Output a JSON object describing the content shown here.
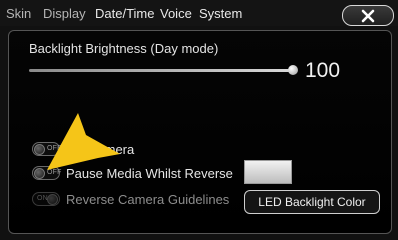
{
  "tabs": [
    {
      "label": "Skin",
      "active": false
    },
    {
      "label": "Display",
      "active": false
    },
    {
      "label": "Date/Time",
      "active": true
    },
    {
      "label": "Voice",
      "active": true
    },
    {
      "label": "System",
      "active": true
    }
  ],
  "close_icon": "close-icon",
  "backlight": {
    "title": "Backlight Brightness (Day mode)",
    "value": "100",
    "level_percent": 100
  },
  "options": [
    {
      "label": "Camera",
      "toggle_text": "OFF",
      "enabled": true
    },
    {
      "label": "Pause Media Whilst Reverse",
      "toggle_text": "OFF",
      "enabled": true
    },
    {
      "label": "Reverse Camera Guidelines",
      "toggle_text": "ON",
      "enabled": false
    }
  ],
  "led_button": {
    "label": "LED Backlight Color"
  },
  "colors": {
    "background": "#111111",
    "arrow": "#f5c518",
    "swatch": "#e0e0e0"
  }
}
